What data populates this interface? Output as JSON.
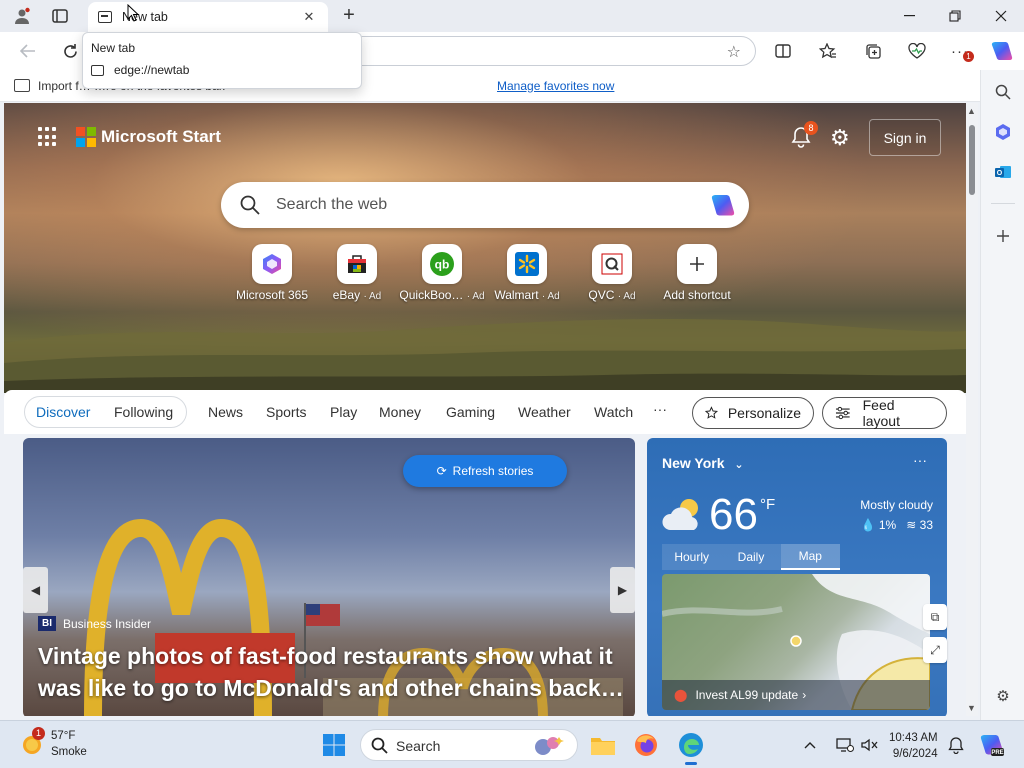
{
  "browser": {
    "tab_title": "New tab",
    "tab_tooltip": {
      "title": "New tab",
      "url": "edge://newtab"
    },
    "favorites_bar": {
      "text": "Import f… …re on the favorites bar.",
      "link": "Manage favorites now"
    },
    "extension_badge": "1"
  },
  "page": {
    "brand": "Microsoft Start",
    "notifications": "8",
    "sign_in": "Sign in",
    "search_placeholder": "Search the web",
    "shortcuts": [
      {
        "label": "Microsoft 365",
        "ad": "",
        "icon": "microsoft365-icon"
      },
      {
        "label": "eBay",
        "ad": "· Ad",
        "icon": "ebay-icon"
      },
      {
        "label": "QuickBoo…",
        "ad": "· Ad",
        "icon": "quickbooks-icon"
      },
      {
        "label": "Walmart",
        "ad": "· Ad",
        "icon": "walmart-icon"
      },
      {
        "label": "QVC",
        "ad": "· Ad",
        "icon": "qvc-icon"
      },
      {
        "label": "Add shortcut",
        "ad": "",
        "icon": "plus-icon"
      }
    ],
    "feed_tabs": [
      "Discover",
      "Following",
      "News",
      "Sports",
      "Play",
      "Money",
      "Gaming",
      "Weather",
      "Watch"
    ],
    "feed_more": "···",
    "personalize": "Personalize",
    "feed_layout": "Feed layout",
    "story": {
      "refresh": "Refresh stories",
      "source": "Business Insider",
      "source_abbr": "BI",
      "headline": "Vintage photos of fast-food restaurants show what it was like to go to McDonald's and other chains back…"
    },
    "weather": {
      "city": "New York",
      "temp": "66",
      "unit": "°F",
      "condition": "Mostly cloudy",
      "precip": "1%",
      "wind": "33",
      "tabs": [
        "Hourly",
        "Daily",
        "Map"
      ],
      "active_tab": "Map",
      "alert": "Invest AL99 update"
    }
  },
  "taskbar": {
    "weather_temp": "57°F",
    "weather_cond": "Smoke",
    "weather_badge": "1",
    "search_placeholder": "Search",
    "time": "10:43 AM",
    "date": "9/6/2024"
  },
  "colors": {
    "accent": "#0f6cbd",
    "weather_card": "#3572bd",
    "refresh_button": "#1f7ae0"
  }
}
